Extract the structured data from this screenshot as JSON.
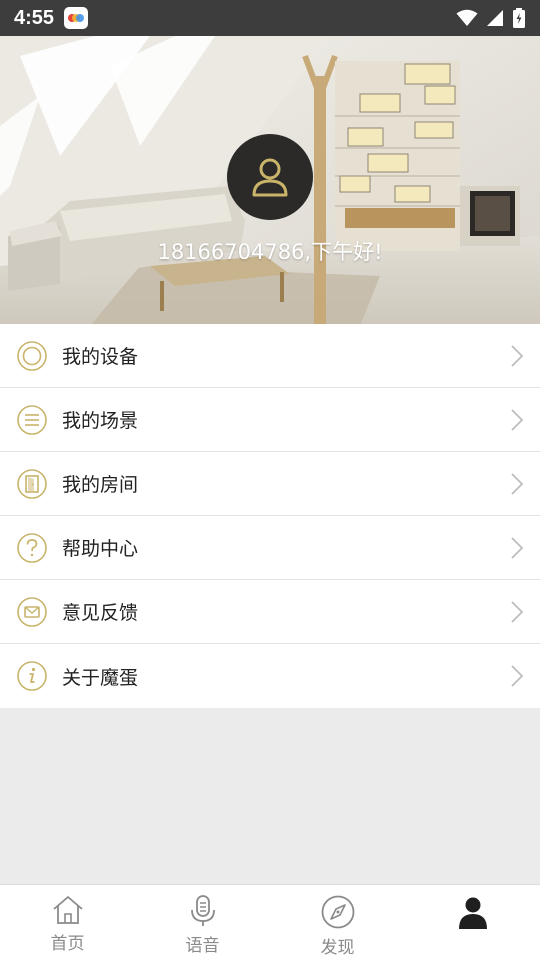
{
  "status_bar": {
    "time": "4:55"
  },
  "profile": {
    "greeting": "18166704786,下午好!"
  },
  "menu": [
    {
      "label": "我的设备",
      "icon": "device-icon"
    },
    {
      "label": "我的场景",
      "icon": "scene-icon"
    },
    {
      "label": "我的房间",
      "icon": "room-icon"
    },
    {
      "label": "帮助中心",
      "icon": "help-icon"
    },
    {
      "label": "意见反馈",
      "icon": "feedback-icon"
    },
    {
      "label": "关于魔蛋",
      "icon": "about-icon"
    }
  ],
  "bottom_nav": [
    {
      "label": "首页",
      "icon": "home-icon"
    },
    {
      "label": "语音",
      "icon": "microphone-icon"
    },
    {
      "label": "发现",
      "icon": "compass-icon"
    },
    {
      "label": "",
      "icon": "person-icon",
      "active": true
    }
  ],
  "colors": {
    "accent": "#c9b46a",
    "status_bar": "#3d3d3d",
    "avatar_bg": "#2b2a28"
  }
}
